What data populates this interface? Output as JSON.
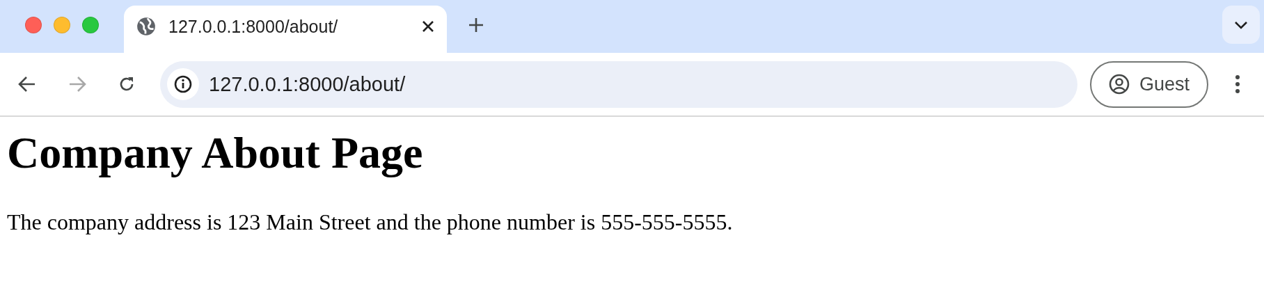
{
  "tab_bar": {
    "tabs": [
      {
        "title": "127.0.0.1:8000/about/",
        "selected": true
      }
    ]
  },
  "toolbar": {
    "forward_disabled": true,
    "address": "127.0.0.1:8000/about/",
    "profile": "Guest"
  },
  "page": {
    "heading": "Company About Page",
    "paragraph": "The company address is 123 Main Street and the phone number is 555-555-5555."
  }
}
